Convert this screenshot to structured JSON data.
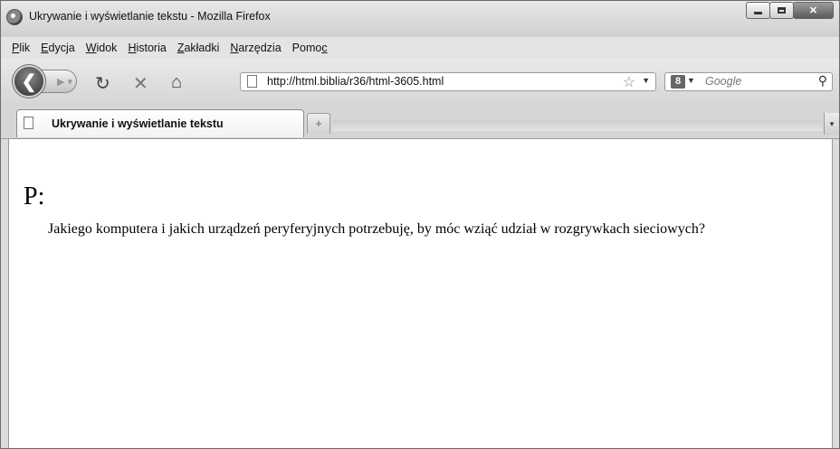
{
  "window": {
    "title": "Ukrywanie i wyświetlanie tekstu - Mozilla Firefox"
  },
  "menu": {
    "items": [
      {
        "first": "P",
        "rest": "lik"
      },
      {
        "first": "E",
        "rest": "dycja"
      },
      {
        "first": "W",
        "rest": "idok"
      },
      {
        "first": "H",
        "rest": "istoria"
      },
      {
        "first": "Z",
        "rest": "akładki"
      },
      {
        "first": "N",
        "rest": "arzędzia"
      },
      {
        "pre": "Pomo",
        "u": "c"
      }
    ]
  },
  "navigation": {
    "url": "http://html.biblia/r36/html-3605.html",
    "search_placeholder": "Google"
  },
  "tabs": [
    {
      "label": "Ukrywanie i wyświetlanie tekstu",
      "active": true
    }
  ],
  "page": {
    "heading": "P:",
    "question": "Jakiego komputera i jakich urządzeń peryferyjnych potrzebuję, by móc wziąć udział w rozgrywkach sieciowych?"
  }
}
